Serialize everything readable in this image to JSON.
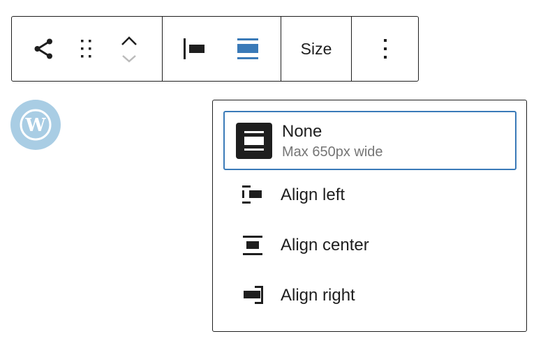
{
  "toolbar": {
    "share_icon": "share-icon",
    "drag_icon": "drag-handle-icon",
    "move_up_icon": "chevron-up-icon",
    "move_down_icon": "chevron-down-icon",
    "align_left_icon": "align-left-icon",
    "align_none_icon": "align-none-icon",
    "size_label": "Size",
    "more_icon": "more-vertical-icon",
    "active_color": "#3a7ab8"
  },
  "logo": {
    "icon": "wordpress-logo-icon",
    "color": "#a9cde4"
  },
  "menu": {
    "options": [
      {
        "label": "None",
        "sublabel": "Max 650px wide",
        "icon": "align-none-icon",
        "selected": true
      },
      {
        "label": "Align left",
        "icon": "align-left-icon"
      },
      {
        "label": "Align center",
        "icon": "align-center-icon"
      },
      {
        "label": "Align right",
        "icon": "align-right-icon"
      }
    ],
    "selected_border_color": "#3a7ab8"
  }
}
